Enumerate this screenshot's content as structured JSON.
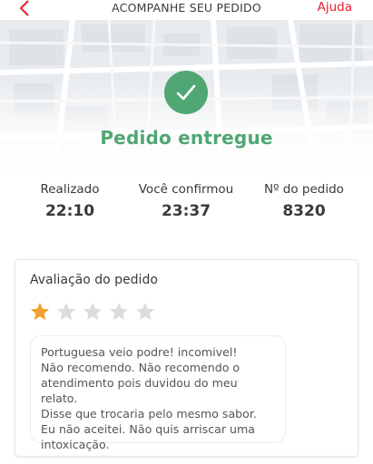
{
  "header": {
    "back_icon": "chevron-left-icon",
    "title": "ACOMPANHE SEU PEDIDO",
    "help_label": "Ajuda"
  },
  "status": {
    "icon": "check-icon",
    "title": "Pedido entregue"
  },
  "order_info": [
    {
      "label": "Realizado",
      "value": "22:10"
    },
    {
      "label": "Você confirmou",
      "value": "23:37"
    },
    {
      "label": "Nº do pedido",
      "value": "8320"
    }
  ],
  "rating": {
    "title": "Avaliação do pedido",
    "stars_selected": 1,
    "stars_total": 5,
    "comment": "Portuguesa veio podre! incomivel!\nNão recomendo. Não recomendo o\natendimento pois duvidou do meu relato.\nDisse que trocaria pelo mesmo sabor.\nEu não aceitei. Não quis arriscar uma\nintoxicação."
  },
  "colors": {
    "accent_red": "#ea1d2c",
    "success_green": "#50a773",
    "star_filled": "#f2a02c",
    "star_empty": "#dcdcdc"
  }
}
